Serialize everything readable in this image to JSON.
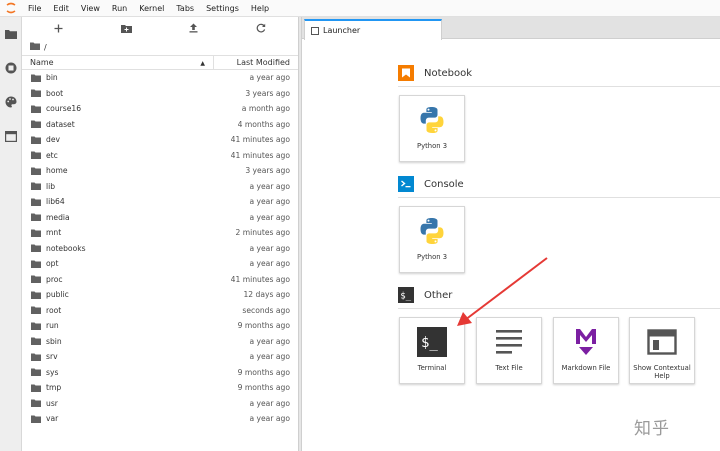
{
  "menu": [
    "File",
    "Edit",
    "View",
    "Run",
    "Kernel",
    "Tabs",
    "Settings",
    "Help"
  ],
  "file_browser": {
    "breadcrumb": "/",
    "columns": {
      "name": "Name",
      "modified": "Last Modified"
    },
    "rows": [
      {
        "name": "bin",
        "modified": "a year ago"
      },
      {
        "name": "boot",
        "modified": "3 years ago"
      },
      {
        "name": "course16",
        "modified": "a month ago"
      },
      {
        "name": "dataset",
        "modified": "4 months ago"
      },
      {
        "name": "dev",
        "modified": "41 minutes ago"
      },
      {
        "name": "etc",
        "modified": "41 minutes ago"
      },
      {
        "name": "home",
        "modified": "3 years ago"
      },
      {
        "name": "lib",
        "modified": "a year ago"
      },
      {
        "name": "lib64",
        "modified": "a year ago"
      },
      {
        "name": "media",
        "modified": "a year ago"
      },
      {
        "name": "mnt",
        "modified": "2 minutes ago"
      },
      {
        "name": "notebooks",
        "modified": "a year ago"
      },
      {
        "name": "opt",
        "modified": "a year ago"
      },
      {
        "name": "proc",
        "modified": "41 minutes ago"
      },
      {
        "name": "public",
        "modified": "12 days ago"
      },
      {
        "name": "root",
        "modified": "seconds ago"
      },
      {
        "name": "run",
        "modified": "9 months ago"
      },
      {
        "name": "sbin",
        "modified": "a year ago"
      },
      {
        "name": "srv",
        "modified": "a year ago"
      },
      {
        "name": "sys",
        "modified": "9 months ago"
      },
      {
        "name": "tmp",
        "modified": "9 months ago"
      },
      {
        "name": "usr",
        "modified": "a year ago"
      },
      {
        "name": "var",
        "modified": "a year ago"
      }
    ]
  },
  "tabs": [
    {
      "label": "Launcher"
    }
  ],
  "launcher": {
    "notebook": {
      "title": "Notebook",
      "cards": [
        {
          "label": "Python 3"
        }
      ]
    },
    "console": {
      "title": "Console",
      "cards": [
        {
          "label": "Python 3"
        }
      ]
    },
    "other": {
      "title": "Other",
      "cards": [
        {
          "label": "Terminal"
        },
        {
          "label": "Text File"
        },
        {
          "label": "Markdown File"
        },
        {
          "label": "Show Contextual Help"
        }
      ]
    }
  },
  "watermark": "知乎",
  "colors": {
    "accent": "#2196f3",
    "folder": "#616161",
    "notebook_orange": "#f57c00",
    "console_blue": "#0288d1",
    "markdown_purple": "#7b1fa2",
    "arrow_red": "#e53935"
  }
}
